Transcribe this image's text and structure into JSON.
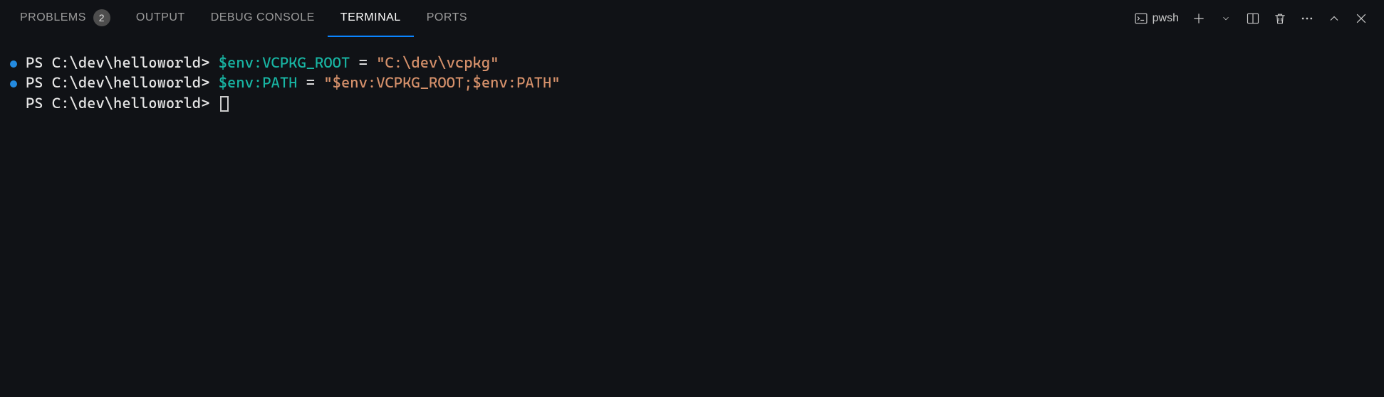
{
  "tabs": [
    {
      "label": "PROBLEMS",
      "badge": "2",
      "active": false
    },
    {
      "label": "OUTPUT",
      "badge": null,
      "active": false
    },
    {
      "label": "DEBUG CONSOLE",
      "badge": null,
      "active": false
    },
    {
      "label": "TERMINAL",
      "badge": null,
      "active": true
    },
    {
      "label": "PORTS",
      "badge": null,
      "active": false
    }
  ],
  "shell_label": "pwsh",
  "terminal_lines": [
    {
      "has_bullet": true,
      "prompt": "PS C:\\dev\\helloworld> ",
      "segments": [
        {
          "cls": "cmd-var",
          "text": "$env:VCPKG_ROOT "
        },
        {
          "cls": "cmd-eq",
          "text": "= "
        },
        {
          "cls": "cmd-str",
          "text": "\"C:\\dev\\vcpkg\""
        }
      ],
      "cursor": false
    },
    {
      "has_bullet": true,
      "prompt": "PS C:\\dev\\helloworld> ",
      "segments": [
        {
          "cls": "cmd-var",
          "text": "$env:PATH "
        },
        {
          "cls": "cmd-eq",
          "text": "= "
        },
        {
          "cls": "cmd-str",
          "text": "\"$env:VCPKG_ROOT;$env:PATH\""
        }
      ],
      "cursor": false
    },
    {
      "has_bullet": false,
      "prompt": "PS C:\\dev\\helloworld> ",
      "segments": [],
      "cursor": true
    }
  ]
}
